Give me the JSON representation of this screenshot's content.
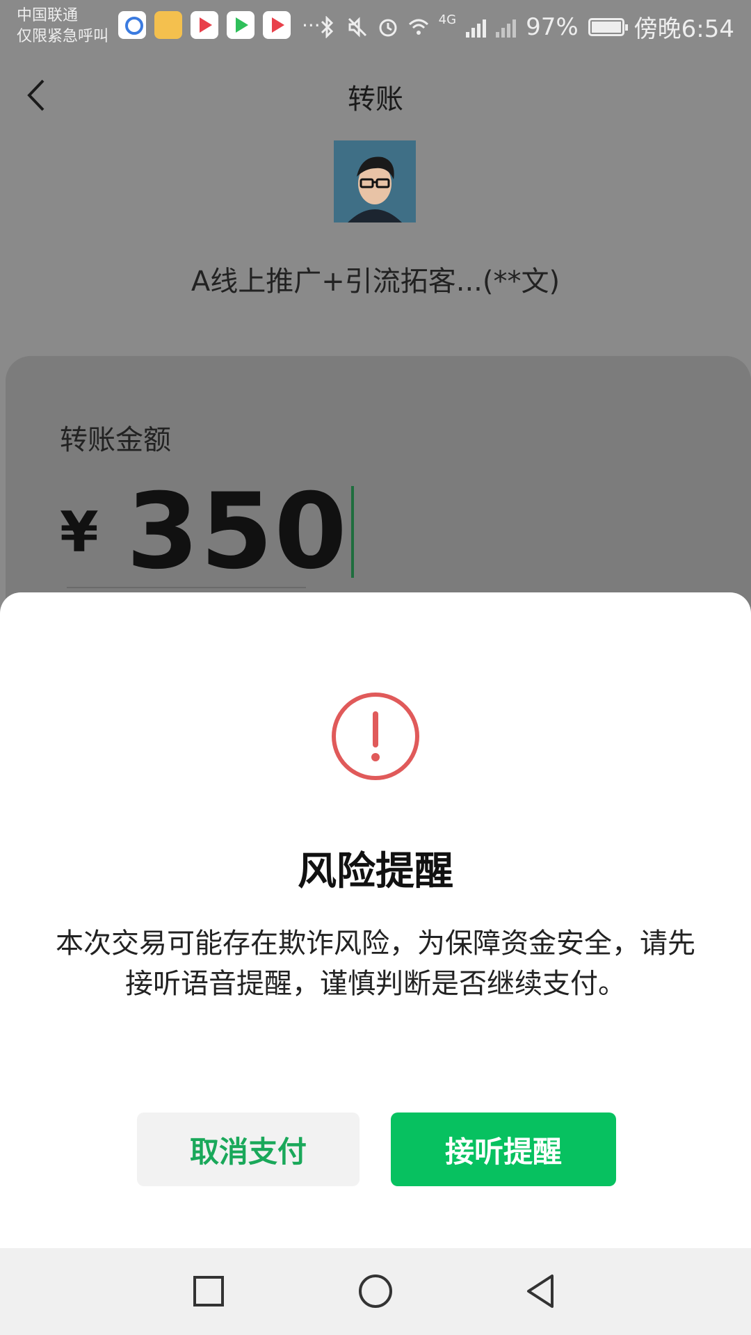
{
  "status_bar": {
    "carrier_line1": "中国联通",
    "carrier_line2": "仅限紧急呼叫",
    "more": "···",
    "network": "4G",
    "battery_percent": "97%",
    "time": "傍晚6:54"
  },
  "header": {
    "title": "转账"
  },
  "recipient": {
    "name": "A线上推广+引流拓客...(**文)"
  },
  "amount": {
    "label": "转账金额",
    "currency_symbol": "¥",
    "value": "350"
  },
  "dialog": {
    "title": "风险提醒",
    "message": "本次交易可能存在欺诈风险，为保障资金安全，请先接听语音提醒，谨慎判断是否继续支付。",
    "cancel_label": "取消支付",
    "confirm_label": "接听提醒"
  },
  "colors": {
    "accent_green": "#07c160",
    "warning_red": "#e05a5a"
  }
}
